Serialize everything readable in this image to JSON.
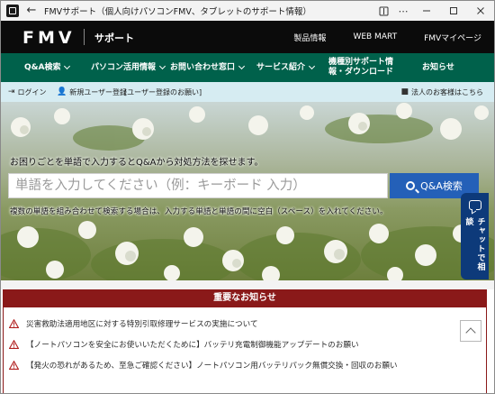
{
  "window": {
    "title": "FMVサポート（個人向けパソコンFMV、タブレットのサポート情報）"
  },
  "header": {
    "logo": "FMV",
    "support_label": "サポート",
    "nav": [
      "製品情報",
      "WEB MART",
      "FMVマイページ"
    ]
  },
  "main_nav": {
    "items": [
      {
        "label": "Q&A検索",
        "dropdown": true
      },
      {
        "label": "パソコン活用情報",
        "dropdown": true
      },
      {
        "label": "お問い合わせ窓口",
        "dropdown": true
      },
      {
        "label": "サービス紹介",
        "dropdown": true
      },
      {
        "label": "機種別サポート情報・ダウンロード",
        "dropdown": false
      },
      {
        "label": "お知らせ",
        "dropdown": false
      }
    ]
  },
  "user_bar": {
    "login": "ログイン",
    "register": "新規ユーザー登録",
    "register_link": "[ユーザー登録のお願い]",
    "corporate": "法人のお客様はこちら"
  },
  "hero": {
    "prompt": "お困りごとを単語で入力するとQ&Aから対処方法を探せます。",
    "search_placeholder": "単語を入力してください（例：キーボード 入力）",
    "search_button": "Q&A検索",
    "hint": "複数の単語を組み合わせて検索する場合は、入力する単語と単語の間に空白（スペース）を入れてください。"
  },
  "chat": {
    "label": "チャットで相談"
  },
  "notices": {
    "heading": "重要なお知らせ",
    "items": [
      "災害救助法適用地区に対する特別引取修理サービスの実施について",
      "【ノートパソコンを安全にお使いいただくために】バッテリ充電制御機能アップデートのお願い",
      "【発火の恐れがあるため、至急ご確認ください】ノートパソコン用バッテリパック無償交換・回収のお願い"
    ]
  },
  "colors": {
    "header_bg": "#0b0b0b",
    "nav_green": "#00614b",
    "userbar_bg": "#d6ecf2",
    "search_button": "#2460b8",
    "chat_tab": "#0d3a7a",
    "notice_red": "#8a1919"
  }
}
